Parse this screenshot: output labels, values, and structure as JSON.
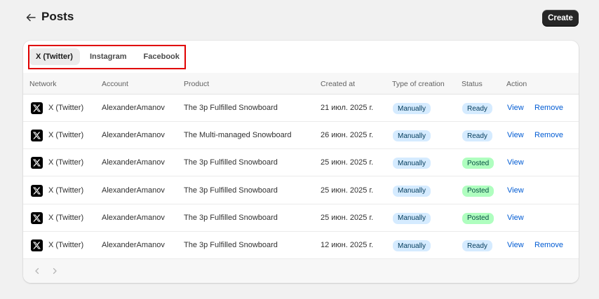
{
  "header": {
    "title": "Posts",
    "create_label": "Create"
  },
  "tabs": [
    {
      "label": "X (Twitter)",
      "active": true
    },
    {
      "label": "Instagram",
      "active": false
    },
    {
      "label": "Facebook",
      "active": false
    }
  ],
  "table": {
    "columns": [
      "Network",
      "Account",
      "Product",
      "Created at",
      "Type of creation",
      "Status",
      "Action"
    ],
    "rows": [
      {
        "network": "X (Twitter)",
        "account": "AlexanderAmanov",
        "product": "The 3p Fulfilled Snowboard",
        "created": "21 июл. 2025 г.",
        "type": "Manually",
        "status": "Ready",
        "view": "View",
        "remove": "Remove"
      },
      {
        "network": "X (Twitter)",
        "account": "AlexanderAmanov",
        "product": "The Multi-managed Snowboard",
        "created": "26 июн. 2025 г.",
        "type": "Manually",
        "status": "Ready",
        "view": "View",
        "remove": "Remove"
      },
      {
        "network": "X (Twitter)",
        "account": "AlexanderAmanov",
        "product": "The 3p Fulfilled Snowboard",
        "created": "25 июн. 2025 г.",
        "type": "Manually",
        "status": "Posted",
        "view": "View",
        "remove": ""
      },
      {
        "network": "X (Twitter)",
        "account": "AlexanderAmanov",
        "product": "The 3p Fulfilled Snowboard",
        "created": "25 июн. 2025 г.",
        "type": "Manually",
        "status": "Posted",
        "view": "View",
        "remove": ""
      },
      {
        "network": "X (Twitter)",
        "account": "AlexanderAmanov",
        "product": "The 3p Fulfilled Snowboard",
        "created": "25 июн. 2025 г.",
        "type": "Manually",
        "status": "Posted",
        "view": "View",
        "remove": ""
      },
      {
        "network": "X (Twitter)",
        "account": "AlexanderAmanov",
        "product": "The 3p Fulfilled Snowboard",
        "created": "12 июн. 2025 г.",
        "type": "Manually",
        "status": "Ready",
        "view": "View",
        "remove": "Remove"
      }
    ]
  },
  "colors": {
    "accent_link": "#005bd3",
    "badge_blue": "#d5ebff",
    "badge_green": "#affebf",
    "highlight": "#e00000"
  },
  "icons": {
    "back": "arrow-left-icon",
    "network": "x-logo-icon",
    "prev": "chevron-left-icon",
    "next": "chevron-right-icon"
  }
}
